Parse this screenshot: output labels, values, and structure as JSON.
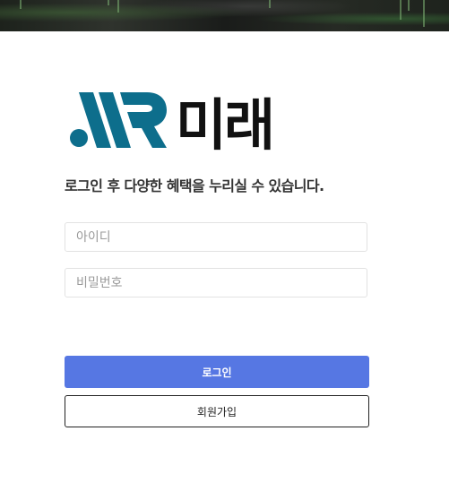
{
  "brand": {
    "logo_mark": "MR",
    "logo_text": "미래",
    "mark_color": "#0d6e8c",
    "text_color": "#111111"
  },
  "login": {
    "tagline": "로그인 후 다양한 혜택을 누리실 수 있습니다.",
    "id_placeholder": "아이디",
    "password_placeholder": "비밀번호",
    "login_label": "로그인",
    "signup_label": "회원가입",
    "accent_color": "#5677e3"
  }
}
